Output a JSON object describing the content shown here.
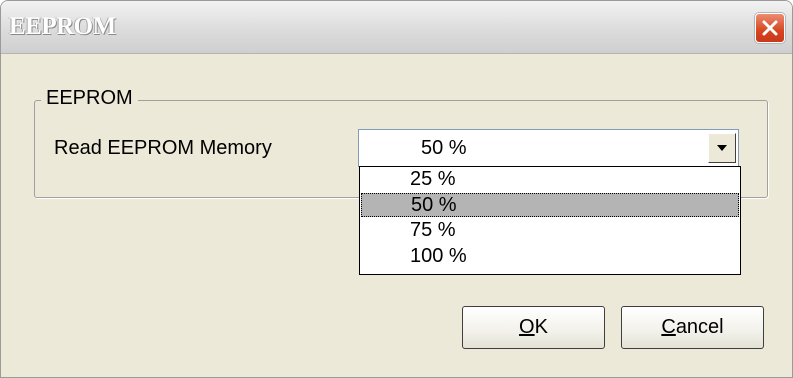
{
  "window": {
    "title": "EEPROM",
    "close_icon": "close-x-icon"
  },
  "group": {
    "legend": "EEPROM",
    "field_label": "Read EEPROM Memory",
    "combo_value": "50 %",
    "dropdown_arrow_icon": "chevron-down-icon",
    "options": [
      "25 %",
      "50 %",
      "75 %",
      "100 %"
    ],
    "selected_option": "50 %"
  },
  "buttons": {
    "ok_mnemonic": "O",
    "ok_rest": "K",
    "cancel_mnemonic": "C",
    "cancel_rest": "ancel"
  },
  "colors": {
    "dialog_bg": "#ece9d8",
    "close_button": "#d6461f",
    "selection_bg": "#b4b4b4"
  }
}
